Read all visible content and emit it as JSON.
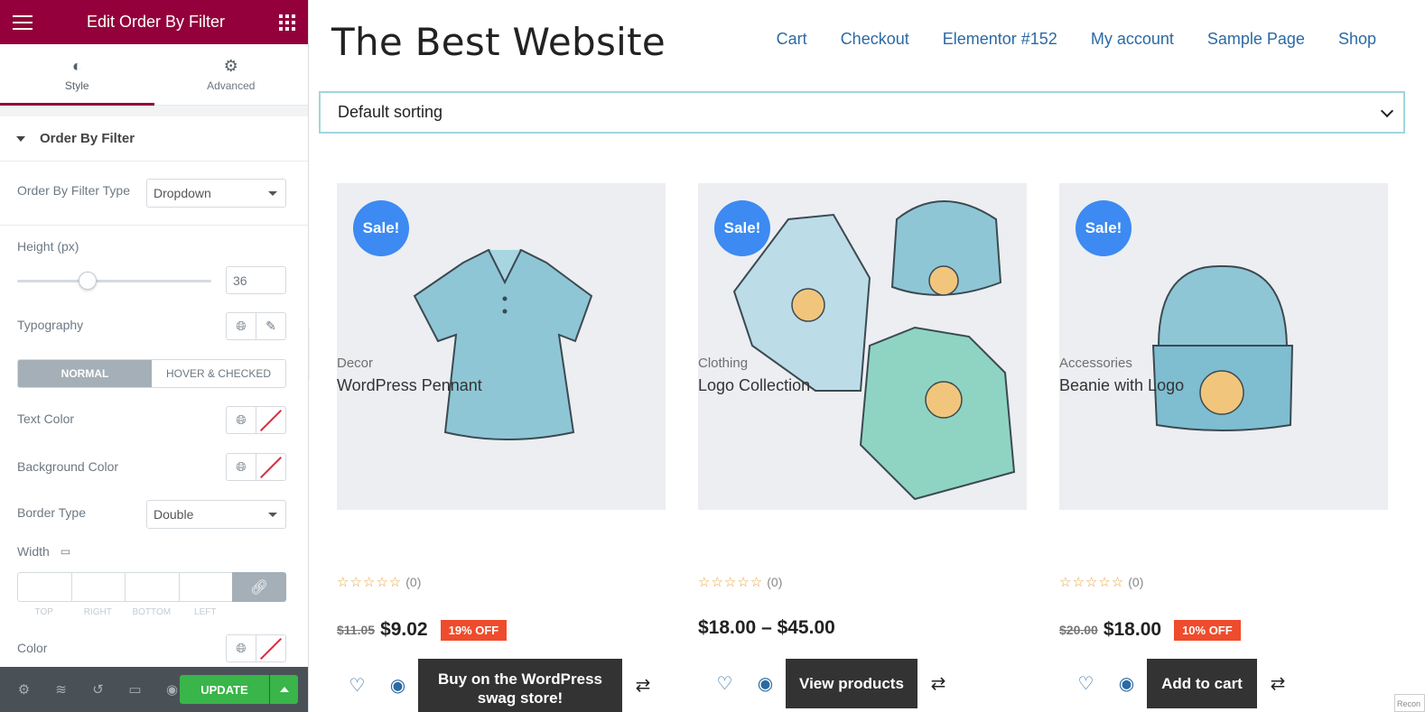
{
  "panel": {
    "title": "Edit Order By Filter",
    "tabs": [
      {
        "label": "Style",
        "icon": "contrast-icon"
      },
      {
        "label": "Advanced",
        "icon": "gear-icon"
      }
    ],
    "section_title": "Order By Filter",
    "controls": {
      "filter_type_label": "Order By Filter Type",
      "filter_type_value": "Dropdown",
      "height_label": "Height (px)",
      "height_value": "36",
      "typography_label": "Typography",
      "toggle_normal": "NORMAL",
      "toggle_hover": "HOVER & CHECKED",
      "text_color_label": "Text Color",
      "bg_color_label": "Background Color",
      "border_type_label": "Border Type",
      "border_type_value": "Double",
      "width_label": "Width",
      "dim_top": "TOP",
      "dim_right": "RIGHT",
      "dim_bottom": "BOTTOM",
      "dim_left": "LEFT",
      "color_label": "Color"
    },
    "update_label": "UPDATE",
    "accent": "#93003c"
  },
  "site": {
    "title": "The Best Website",
    "nav": [
      "Cart",
      "Checkout",
      "Elementor #152",
      "My account",
      "Sample Page",
      "Shop"
    ],
    "sorting_value": "Default sorting"
  },
  "products": [
    {
      "badge": "Sale!",
      "category": "Decor",
      "name": "WordPress Pennant",
      "rating_count": "(0)",
      "old_price": "$11.05",
      "price": "$9.02",
      "discount": "19% OFF",
      "button": "Buy on the WordPress swag store!"
    },
    {
      "badge": "Sale!",
      "category": "Clothing",
      "name": "Logo Collection",
      "rating_count": "(0)",
      "old_price": "",
      "price": "$18.00 – $45.00",
      "discount": "",
      "button": "View products"
    },
    {
      "badge": "Sale!",
      "category": "Accessories",
      "name": "Beanie with Logo",
      "rating_count": "(0)",
      "old_price": "$20.00",
      "price": "$18.00",
      "discount": "10% OFF",
      "button": "Add to cart"
    }
  ],
  "recon_label": "Recon",
  "colors": {
    "sale_badge": "#3c8af2",
    "discount": "#ee4c2c",
    "update": "#39b54a",
    "link": "#2b6aa3"
  }
}
